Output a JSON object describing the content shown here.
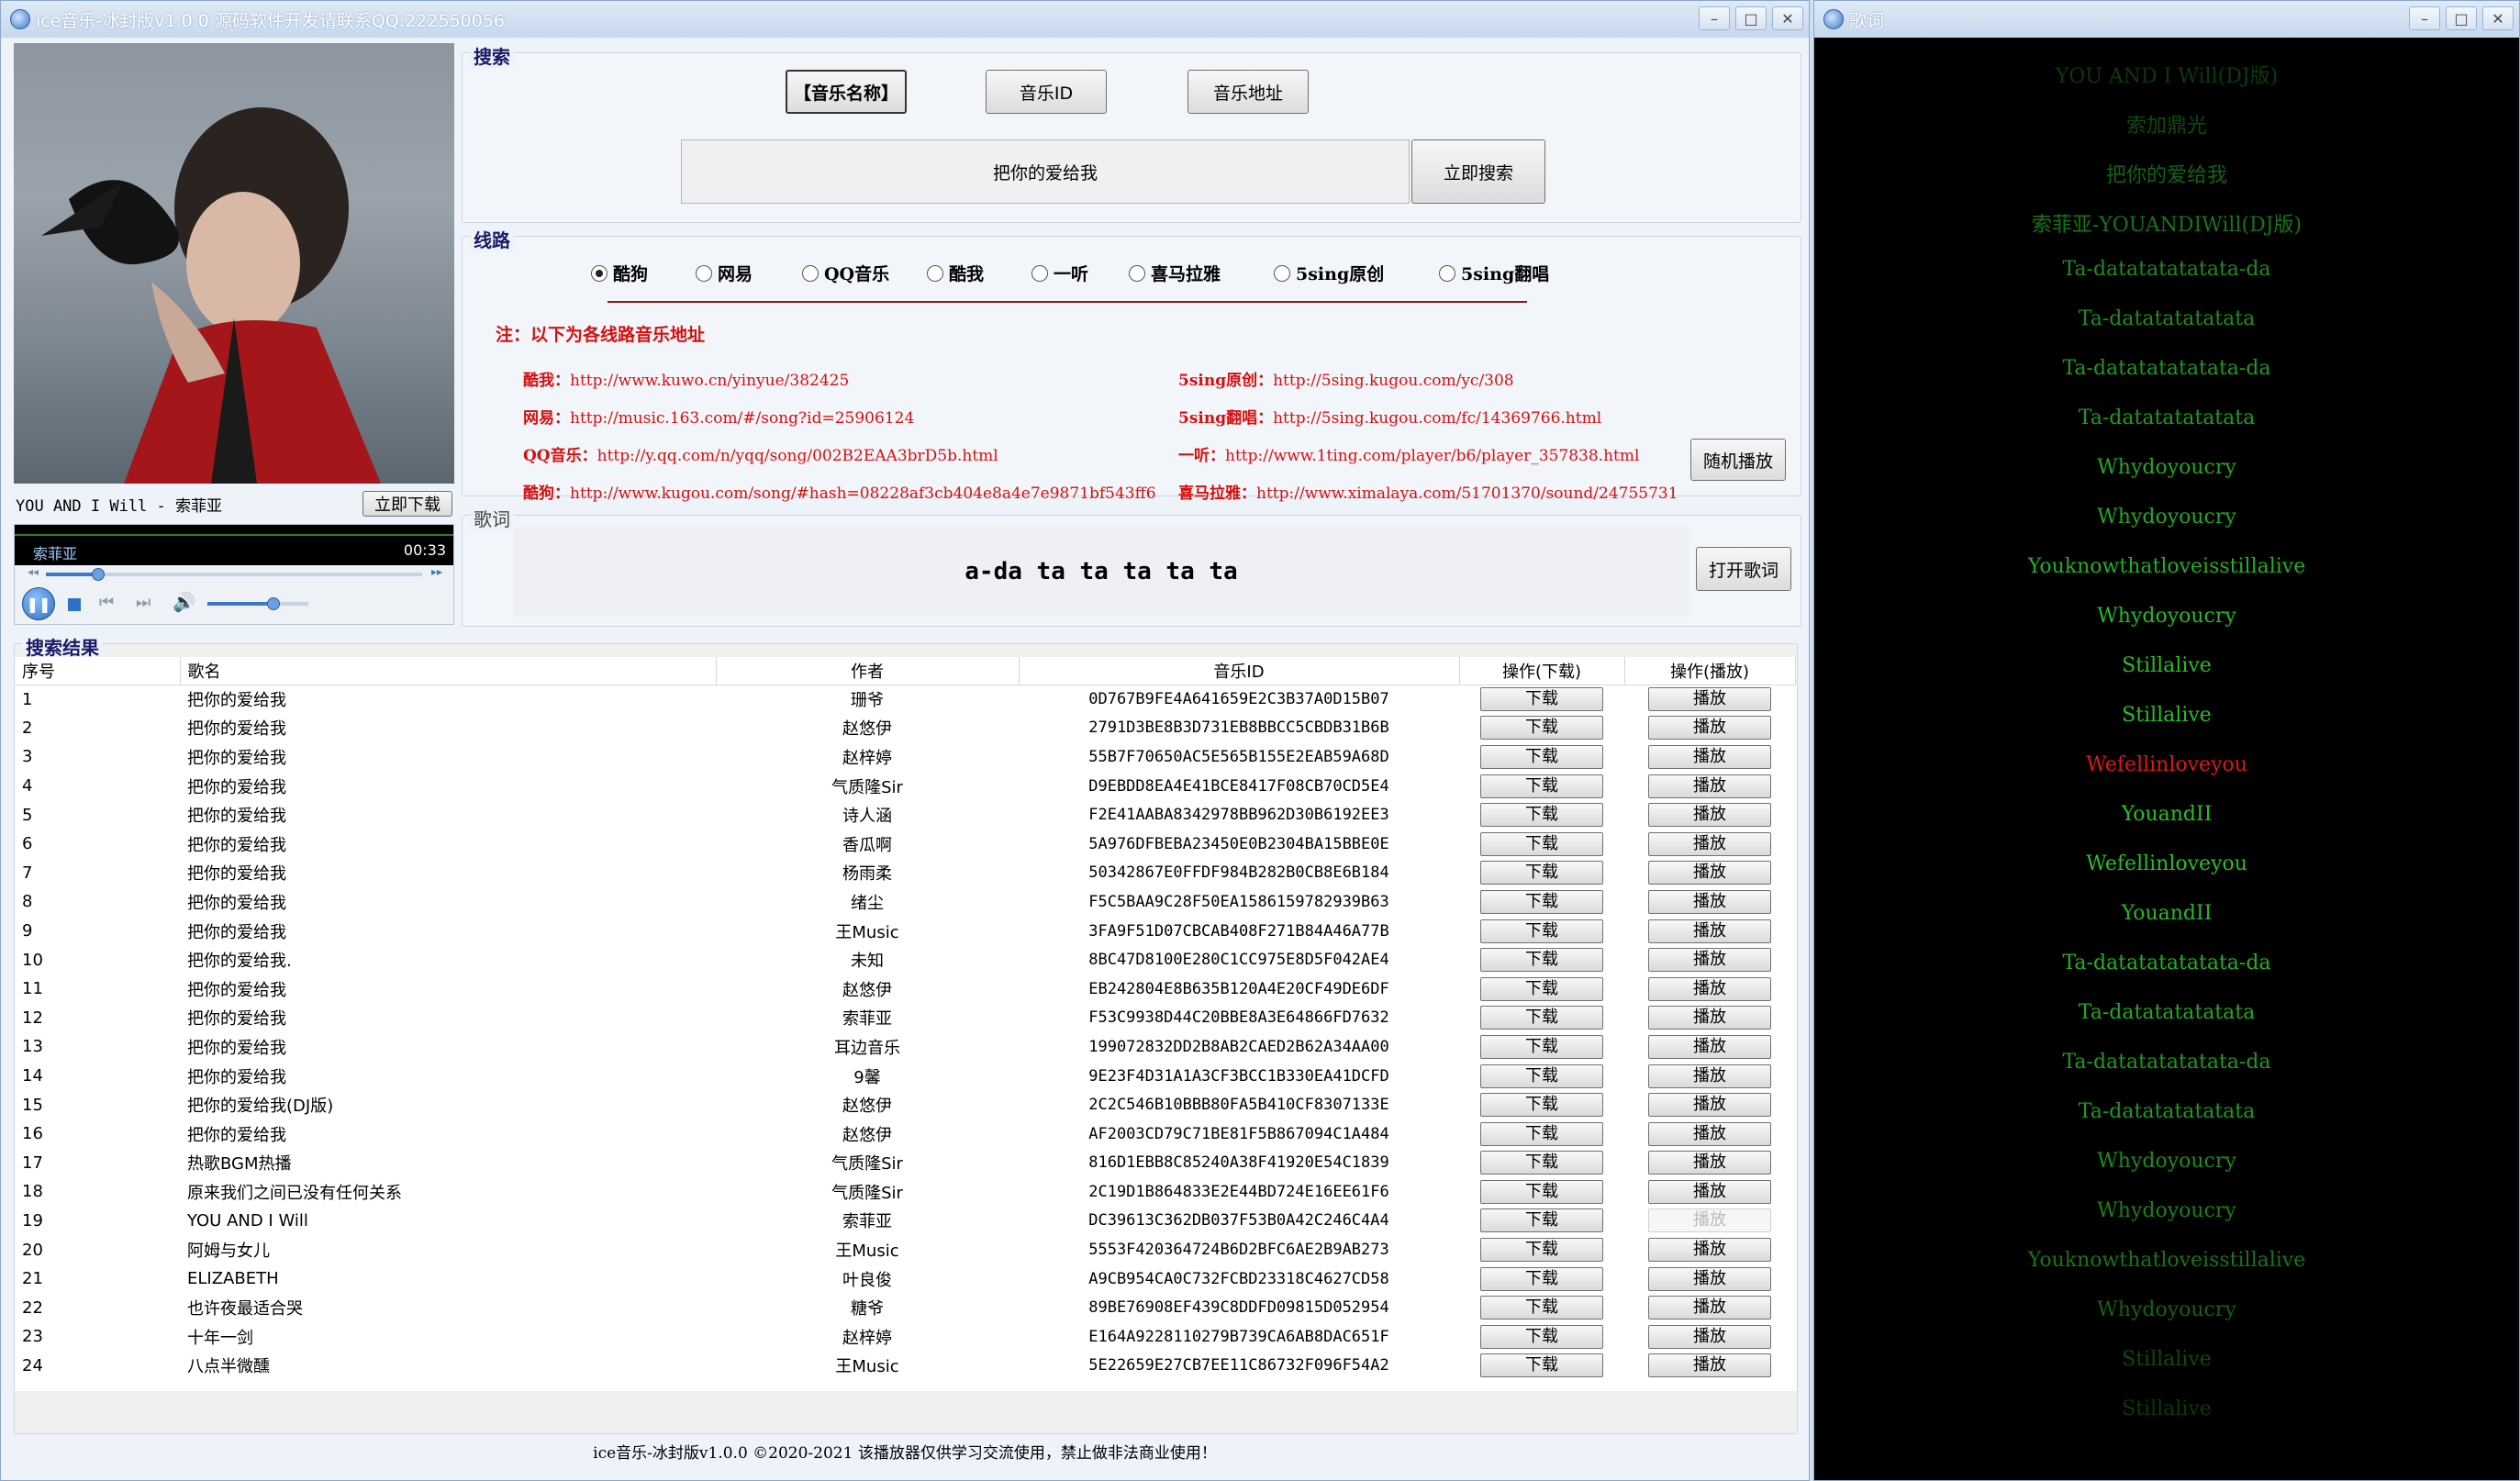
{
  "main_window": {
    "title": "ice音乐-冰封版v1.0.0  源码软件开发请联系QQ:222550056",
    "buttons": {
      "minimize": "–",
      "maximize": "□",
      "close": "✕"
    }
  },
  "lyrics_window": {
    "title": "歌词",
    "lines": [
      {
        "text": "YOU AND I Will(DJ版)",
        "color": "#0b3a0b"
      },
      {
        "text": "索加鼎光",
        "color": "#0e4a0e"
      },
      {
        "text": "把你的爱给我",
        "color": "#136313"
      },
      {
        "text": "索菲亚-YOUANDIWill(DJ版)",
        "color": "#177517"
      },
      {
        "text": "Ta-datatatatatata-da",
        "color": "#1e8c1e"
      },
      {
        "text": "Ta-datatatatatata",
        "color": "#1e8c1e"
      },
      {
        "text": "Ta-datatatatatata-da",
        "color": "#1e9a1e"
      },
      {
        "text": "Ta-datatatatatata",
        "color": "#1e9a1e"
      },
      {
        "text": "Whydoyoucry",
        "color": "#22a822"
      },
      {
        "text": "Whydoyoucry",
        "color": "#22a822"
      },
      {
        "text": "Youknowthatloveisstillalive",
        "color": "#22b022"
      },
      {
        "text": "Whydoyoucry",
        "color": "#26b826"
      },
      {
        "text": "Stillalive",
        "color": "#26c026"
      },
      {
        "text": "Stillalive",
        "color": "#26c026"
      },
      {
        "text": "Wefellinloveyou",
        "color": "#e01818"
      },
      {
        "text": "YouandII",
        "color": "#26c026"
      },
      {
        "text": "Wefellinloveyou",
        "color": "#26c026"
      },
      {
        "text": "YouandII",
        "color": "#26b826"
      },
      {
        "text": "Ta-datatatatatata-da",
        "color": "#22b022"
      },
      {
        "text": "Ta-datatatatatata",
        "color": "#22a822"
      },
      {
        "text": "Ta-datatatatatata-da",
        "color": "#1e9a1e"
      },
      {
        "text": "Ta-datatatatatata",
        "color": "#1e9a1e"
      },
      {
        "text": "Whydoyoucry",
        "color": "#1e8c1e"
      },
      {
        "text": "Whydoyoucry",
        "color": "#1a801a"
      },
      {
        "text": "Youknowthatloveisstillalive",
        "color": "#177517"
      },
      {
        "text": "Whydoyoucry",
        "color": "#136313"
      },
      {
        "text": "Stillalive",
        "color": "#0e4a0e"
      },
      {
        "text": "Stillalive",
        "color": "#0b3a0b"
      }
    ]
  },
  "player": {
    "now_playing": "YOU AND I Will - 索菲亚",
    "download_now": "立即下载",
    "artist": "索菲亚",
    "time": "00:33",
    "progress": 0.14,
    "volume": 0.65
  },
  "search": {
    "group_title": "搜索",
    "mode_name": "【音乐名称】",
    "mode_id": "音乐ID",
    "mode_url": "音乐地址",
    "query": "把你的爱给我",
    "submit": "立即搜索"
  },
  "routes": {
    "group_title": "线路",
    "options": [
      "酷狗",
      "网易",
      "QQ音乐",
      "酷我",
      "一听",
      "喜马拉雅",
      "5sing原创",
      "5sing翻唱"
    ],
    "selected": "酷狗",
    "note": "注：以下为各线路音乐地址",
    "urls_left": [
      {
        "label": "酷我：",
        "url": "http://www.kuwo.cn/yinyue/382425"
      },
      {
        "label": "网易：",
        "url": "http://music.163.com/#/song?id=25906124"
      },
      {
        "label": "QQ音乐：",
        "url": "http://y.qq.com/n/yqq/song/002B2EAA3brD5b.html"
      },
      {
        "label": "酷狗：",
        "url": "http://www.kugou.com/song/#hash=08228af3cb404e8a4e7e9871bf543ff6"
      }
    ],
    "urls_right": [
      {
        "label": "5sing原创：",
        "url": "http://5sing.kugou.com/yc/308"
      },
      {
        "label": "5sing翻唱：",
        "url": "http://5sing.kugou.com/fc/14369766.html"
      },
      {
        "label": "一听：",
        "url": "http://www.1ting.com/player/b6/player_357838.html"
      },
      {
        "label": "喜马拉雅：",
        "url": "http://www.ximalaya.com/51701370/sound/24755731"
      }
    ],
    "random_play": "随机播放"
  },
  "lyrics_panel": {
    "group_title": "歌词",
    "current_line": "a-da ta ta ta ta ta",
    "open_lyrics": "打开歌词"
  },
  "results": {
    "group_title": "搜索结果",
    "columns": [
      "序号",
      "歌名",
      "作者",
      "音乐ID",
      "操作(下载)",
      "操作(播放)"
    ],
    "download_label": "下载",
    "play_label": "播放",
    "rows": [
      [
        "1",
        "把你的爱给我",
        "珊爷",
        "0D767B9FE4A641659E2C3B37A0D15B07"
      ],
      [
        "2",
        "把你的爱给我",
        "赵悠伊",
        "2791D3BE8B3D731EB8BBCC5CBDB31B6B"
      ],
      [
        "3",
        "把你的爱给我",
        "赵梓婷",
        "55B7F70650AC5E565B155E2EAB59A68D"
      ],
      [
        "4",
        "把你的爱给我",
        "气质隆Sir",
        "D9EBDD8EA4E41BCE8417F08CB70CD5E4"
      ],
      [
        "5",
        "把你的爱给我",
        "诗人涵",
        "F2E41AABA8342978BB962D30B6192EE3"
      ],
      [
        "6",
        "把你的爱给我",
        "香瓜啊",
        "5A976DFBEBA23450E0B2304BA15BBE0E"
      ],
      [
        "7",
        "把你的爱给我",
        "杨雨柔",
        "50342867E0FFDF984B282B0CB8E6B184"
      ],
      [
        "8",
        "把你的爱给我",
        "绪尘",
        "F5C5BAA9C28F50EA1586159782939B63"
      ],
      [
        "9",
        "把你的爱给我",
        "王Music",
        "3FA9F51D07CBCAB408F271B84A46A77B"
      ],
      [
        "10",
        "把你的爱给我.",
        "未知",
        "8BC47D8100E280C1CC975E8D5F042AE4"
      ],
      [
        "11",
        "把你的爱给我",
        "赵悠伊",
        "EB242804E8B635B120A4E20CF49DE6DF"
      ],
      [
        "12",
        "把你的爱给我",
        "索菲亚",
        "F53C9938D44C20BBE8A3E64866FD7632"
      ],
      [
        "13",
        "把你的爱给我",
        "耳边音乐",
        "199072832DD2B8AB2CAED2B62A34AA00"
      ],
      [
        "14",
        "把你的爱给我",
        "9馨",
        "9E23F4D31A1A3CF3BCC1B330EA41DCFD"
      ],
      [
        "15",
        "把你的爱给我(DJ版)",
        "赵悠伊",
        "2C2C546B10BBB80FA5B410CF8307133E"
      ],
      [
        "16",
        "把你的爱给我",
        "赵悠伊",
        "AF2003CD79C71BE81F5B867094C1A484"
      ],
      [
        "17",
        "热歌BGM热播",
        "气质隆Sir",
        "816D1EBB8C85240A38F41920E54C1839"
      ],
      [
        "18",
        "原来我们之间已没有任何关系",
        "气质隆Sir",
        "2C19D1B864833E2E44BD724E16EE61F6"
      ],
      [
        "19",
        "YOU AND I Will",
        "索菲亚",
        "DC39613C362DB037F53B0A42C246C4A4"
      ],
      [
        "20",
        "阿姆与女儿",
        "王Music",
        "5553F420364724B6D2BFC6AE2B9AB273"
      ],
      [
        "21",
        "ELIZABETH",
        "叶良俊",
        "A9CB954CA0C732FCBD23318C4627CD58"
      ],
      [
        "22",
        "也许夜最适合哭",
        "糖爷",
        "89BE76908EF439C8DDFD09815D052954"
      ],
      [
        "23",
        "十年一剑",
        "赵梓婷",
        "E164A9228110279B739CA6AB8DAC651F"
      ],
      [
        "24",
        "八点半微醺",
        "王Music",
        "5E22659E27CB7EE11C86732F096F54A2"
      ]
    ],
    "playing_row": "19"
  },
  "footer": "ice音乐-冰封版v1.0.0 ©2020-2021 该播放器仅供学习交流使用，禁止做非法商业使用！",
  "colors": {
    "lyrics_bg": "#000000",
    "url_red": "#d4100f",
    "accent_blue": "#3f77c6"
  }
}
